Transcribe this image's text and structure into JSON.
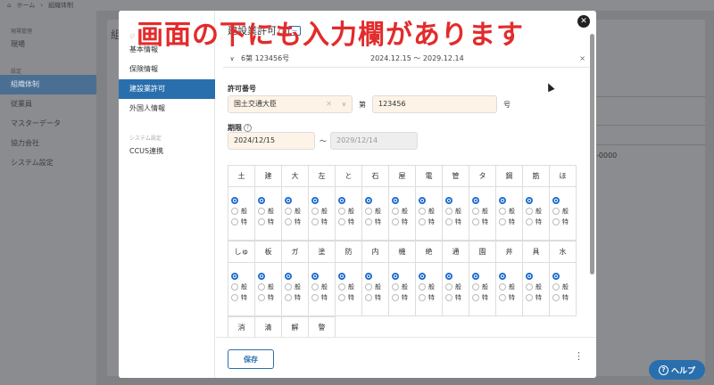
{
  "background": {
    "breadcrumb": {
      "home": "ホーム",
      "current": "組織体制"
    },
    "page_title": "組",
    "sidebar": {
      "group1": "現場管理",
      "item_site": "現場",
      "group2": "設定",
      "items": [
        "組織体制",
        "従業員",
        "マスターデータ",
        "協力会社",
        "システム設定"
      ]
    },
    "cell_text": "-0000"
  },
  "modal": {
    "title": "建設業許可",
    "title_pill": "一",
    "side": {
      "top_label": "ジ",
      "items": [
        "基本情報",
        "保険情報",
        "建設業許可",
        "外国人情報"
      ],
      "system_label": "システム設定",
      "ccus": "CCUS連携"
    },
    "permit": {
      "number": "6第 123456号",
      "dates": "2024.12.15 ～ 2029.12.14",
      "remove": "×"
    },
    "form": {
      "permit_no_label": "許可番号",
      "authority": "国土交通大臣",
      "dai": "第",
      "number_value": "123456",
      "go": "号",
      "period_label": "期限",
      "start": "2024/12/15",
      "tilde": "～",
      "end": "2029/12/14"
    },
    "types_row1": [
      "土",
      "建",
      "大",
      "左",
      "と",
      "石",
      "屋",
      "電",
      "管",
      "タ",
      "鋼",
      "筋",
      "ほ"
    ],
    "types_row2": [
      "しゅ",
      "板",
      "ガ",
      "塗",
      "防",
      "内",
      "機",
      "絶",
      "通",
      "園",
      "井",
      "具",
      "水"
    ],
    "types_row3": [
      "消",
      "清",
      "解",
      "警"
    ],
    "option_general": "般",
    "option_special": "特",
    "save": "保存",
    "more": "⋮"
  },
  "banner": "画面の下にも入力欄があります",
  "help": "ヘルプ",
  "colors": {
    "accent": "#2a6fad",
    "banner": "#e32b2b",
    "field_bg": "#fdf3e7"
  }
}
